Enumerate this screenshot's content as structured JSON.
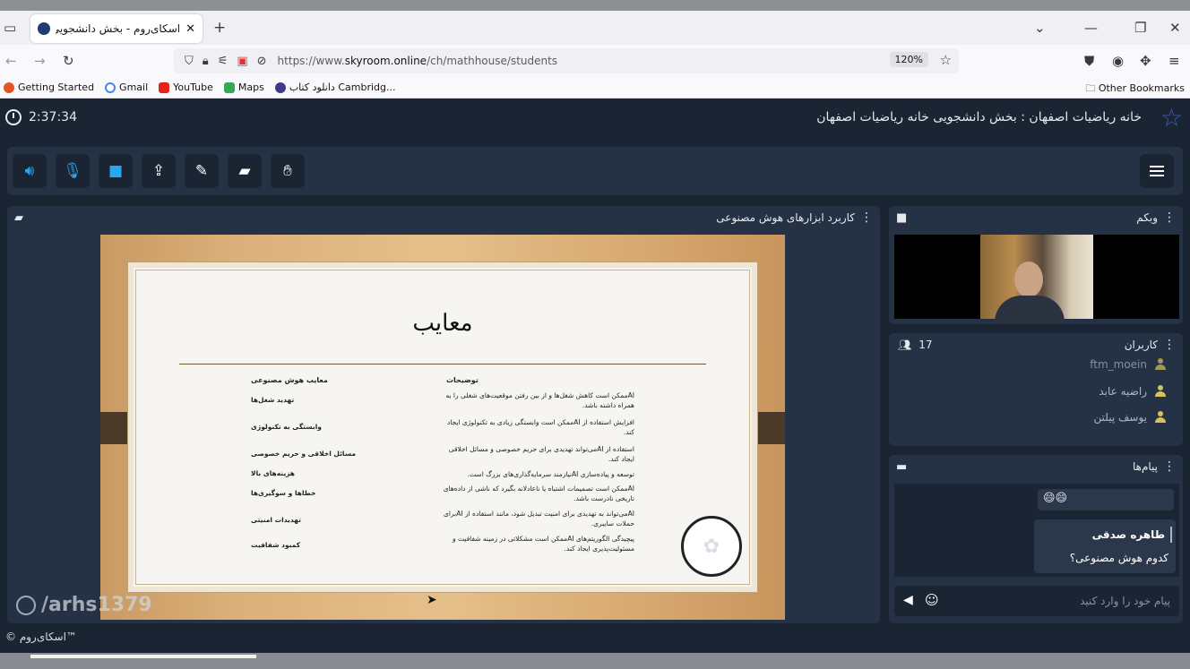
{
  "browser": {
    "tab_title": "اسکای‌روم - بخش دانشجویی خا",
    "tab_close": "✕",
    "new_tab": "+",
    "url_prefix": "https://www.",
    "url_domain": "skyroom.online",
    "url_path": "/ch/mathhouse/students",
    "zoom": "120%",
    "bookmarks": [
      "Getting Started",
      "Gmail",
      "YouTube",
      "Maps",
      "دانلود کتاب",
      "Cambridg..."
    ],
    "other_bookmarks": "Other Bookmarks"
  },
  "app": {
    "timer": "2:37:34",
    "room_title": "خانه ریاضیات اصفهان : بخش دانشجویی خانه ریاضیات اصفهان",
    "footer": "© اسکای‌روم™"
  },
  "presentation": {
    "title": "کاربرد ابزارهای هوش مصنوعی",
    "slide_heading": "معایب",
    "col_name": "معایب هوش مصنوعی",
    "col_desc": "توضیحات",
    "rows": [
      {
        "name": "تهدید شغل‌ها",
        "desc": "AIممکن است کاهش شغل‌ها و از بین رفتن موقعیت‌های شغلی را به همراه داشته باشد."
      },
      {
        "name": "وابستگی به تکنولوژی",
        "desc": "افزایش استفاده از AIممکن است وابستگی زیادی به تکنولوژی ایجاد کند."
      },
      {
        "name": "مسائل اخلاقی و حریم خصوصی",
        "desc": "استفاده از AIمی‌تواند تهدیدی برای حریم خصوصی و مسائل اخلاقی ایجاد کند."
      },
      {
        "name": "هزینه‌های بالا",
        "desc": "توسعه و پیاده‌سازی AIنیازمند سرمایه‌گذاری‌های بزرگ است."
      },
      {
        "name": "خطاها و سوگیری‌ها",
        "desc": "AIممکن است تصمیمات اشتباه یا ناعادلانه بگیرد که ناشی از داده‌های تاریخی نادرست باشد."
      },
      {
        "name": "تهدیدات امنیتی",
        "desc": "AIمی‌تواند به تهدیدی برای امنیت تبدیل شود، مانند استفاده از AIبرای حملات سایبری."
      },
      {
        "name": "کمبود شفافیت",
        "desc": "پیچیدگی الگوریتم‌های AIممکن است مشکلاتی در زمینه شفافیت و مسئولیت‌پذیری ایجاد کند."
      }
    ],
    "watermark": "/arhs1379"
  },
  "webcam": {
    "title": "وبکم"
  },
  "users": {
    "title": "کاربران",
    "count": "17",
    "list": [
      "ftm_moein",
      "راضیه عابد",
      "یوسف پیلتن"
    ]
  },
  "messages": {
    "title": "پیام‌ها",
    "emoji": "😄😄",
    "last_author": "طاهره صدقی",
    "last_text": "کدوم هوش مصنوعی؟",
    "input_placeholder": "پیام خود را وارد کنید"
  },
  "colors": {
    "accent": "#29a8f0",
    "panel": "#253246",
    "bg": "#1b2433"
  }
}
